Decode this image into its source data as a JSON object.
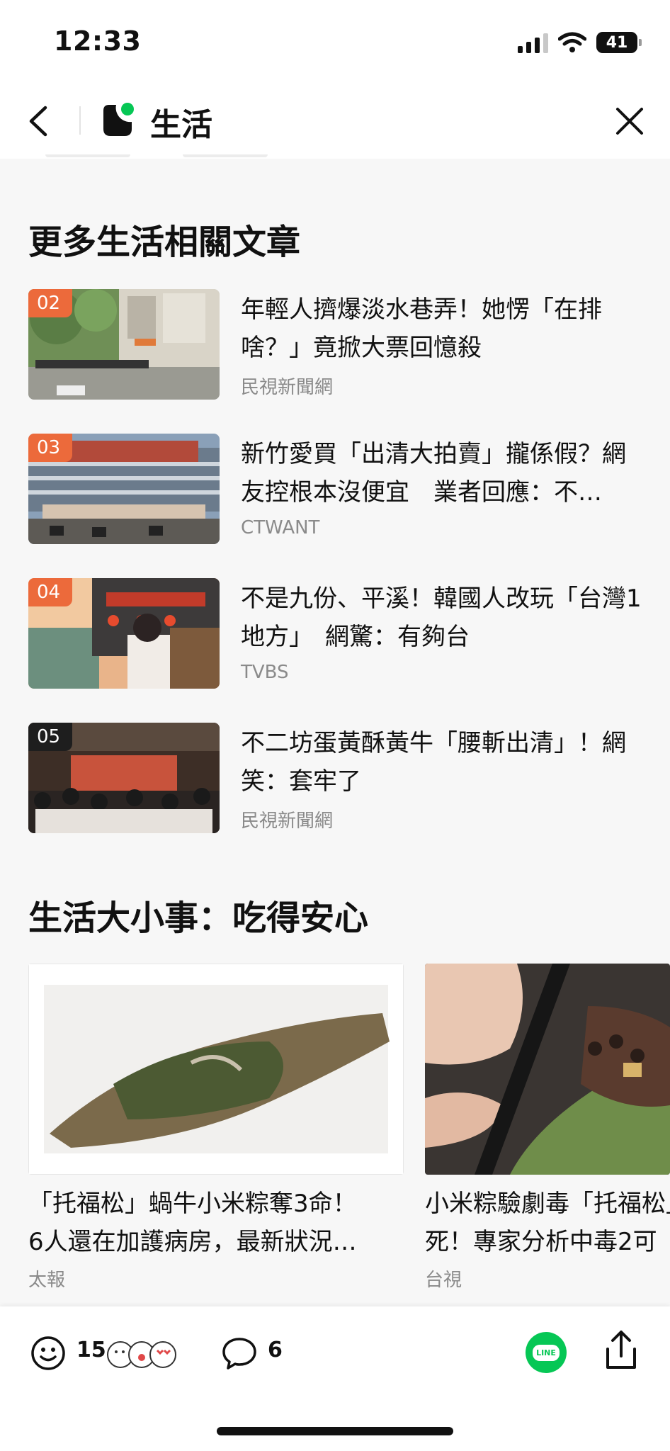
{
  "status": {
    "time": "12:33",
    "battery": "41"
  },
  "nav": {
    "title": "生活",
    "back_icon": "chevron-left-icon",
    "close_icon": "close-icon",
    "logo_color": "#06c755"
  },
  "more": {
    "title": "更多生活相關文章",
    "articles": [
      {
        "rank": "02",
        "title": "年輕人擠爆淡水巷弄！她愣「在排啥？」竟掀大票回憶殺",
        "source": "民視新聞網"
      },
      {
        "rank": "03",
        "title": "新竹愛買「出清大拍賣」攏係假？網友控根本沒便宜　業者回應：不…",
        "source": "CTWANT"
      },
      {
        "rank": "04",
        "title": "不是九份、平溪！韓國人改玩「台灣1地方」　網驚：有夠台",
        "source": "TVBS"
      },
      {
        "rank": "05",
        "title": "不二坊蛋黃酥黃牛「腰斬出清」！網笑：套牢了",
        "source": "民視新聞網"
      }
    ]
  },
  "life": {
    "title": "生活大小事：吃得安心",
    "cards": [
      {
        "title_line1": "「托福松」蝸牛小米粽奪3命！",
        "title_line2": "6人還在加護病房，最新狀況…",
        "source": "太報"
      },
      {
        "title_line1": "小米粽驗劇毒「托福松」",
        "title_line2": "死！專家分析中毒2可",
        "source": "台視"
      }
    ]
  },
  "actions": {
    "reaction_count": "15",
    "comment_count": "6",
    "line_label": "LINE"
  },
  "colors": {
    "accent": "#ec6a3b",
    "line_green": "#06c755",
    "secondary_text": "#8a8a8a"
  }
}
